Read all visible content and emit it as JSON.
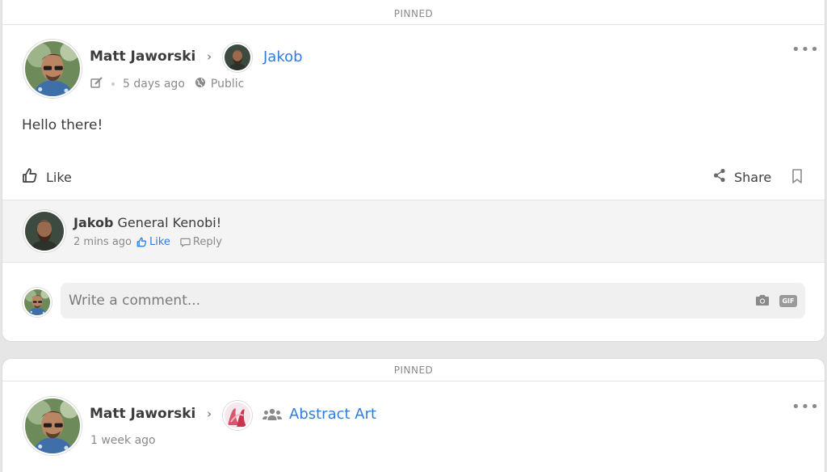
{
  "posts": [
    {
      "pinned_label": "PINNED",
      "author": "Matt Jaworski",
      "target": "Jakob",
      "time": "5 days ago",
      "visibility": "Public",
      "content": "Hello there!",
      "actions": {
        "like": "Like",
        "share": "Share"
      },
      "comments": [
        {
          "author": "Jakob",
          "text": "General Kenobi!",
          "time": "2 mins ago",
          "like": "Like",
          "reply": "Reply"
        }
      ],
      "composer": {
        "placeholder": "Write a comment...",
        "gif_label": "GIF"
      }
    },
    {
      "pinned_label": "PINNED",
      "author": "Matt Jaworski",
      "target": "Abstract Art",
      "time": "1 week ago"
    }
  ],
  "colors": {
    "accent": "#2f7de0",
    "muted": "#8a8a8a",
    "comment_bg": "#f4f4f4"
  }
}
